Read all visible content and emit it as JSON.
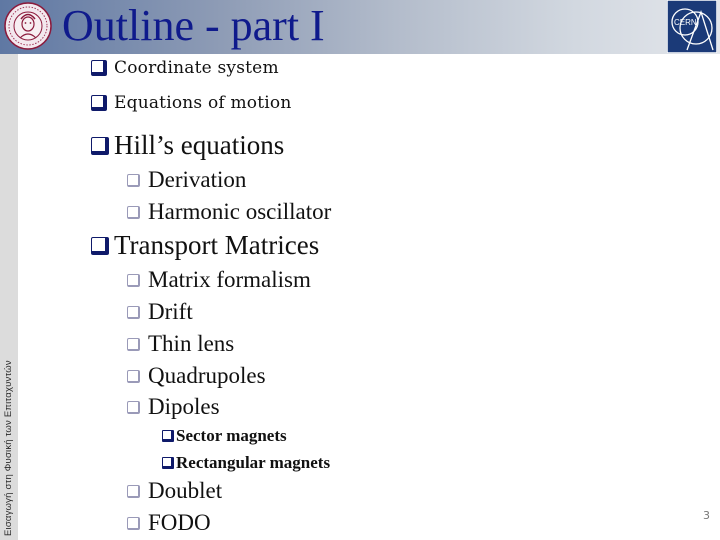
{
  "header": {
    "title": "Outline - part I",
    "left_logo": "university-seal-icon",
    "right_logo": "cern-logo-icon",
    "right_logo_text": "CERN"
  },
  "sidebar": {
    "text": "Εισαγωγή στη Φυσική των Επιταχυντών"
  },
  "outline": [
    {
      "level": 1,
      "style": "small",
      "label": "Coordinate system"
    },
    {
      "level": 1,
      "style": "small",
      "label": "Equations of motion"
    },
    {
      "level": 1,
      "style": "big",
      "label": "Hill’s equations"
    },
    {
      "level": 2,
      "label": "Derivation"
    },
    {
      "level": 2,
      "label": "Harmonic oscillator"
    },
    {
      "level": 1,
      "style": "big",
      "label": "Transport Matrices"
    },
    {
      "level": 2,
      "label": "Matrix formalism"
    },
    {
      "level": 2,
      "label": "Drift"
    },
    {
      "level": 2,
      "label": "Thin lens"
    },
    {
      "level": 2,
      "label": "Quadrupoles"
    },
    {
      "level": 2,
      "label": "Dipoles"
    },
    {
      "level": 3,
      "label": "Sector magnets"
    },
    {
      "level": 3,
      "label": "Rectangular magnets"
    },
    {
      "level": 2,
      "label": "Doublet"
    },
    {
      "level": 2,
      "label": "FODO"
    }
  ],
  "footer": {
    "page_number": "3"
  },
  "colors": {
    "title": "#0f1a8c",
    "bullet_primary": "#0f1a6a",
    "bullet_secondary": "#9a9ab8",
    "sidebar_bg": "#dcdcdc",
    "cern_bg": "#1b3a78"
  }
}
